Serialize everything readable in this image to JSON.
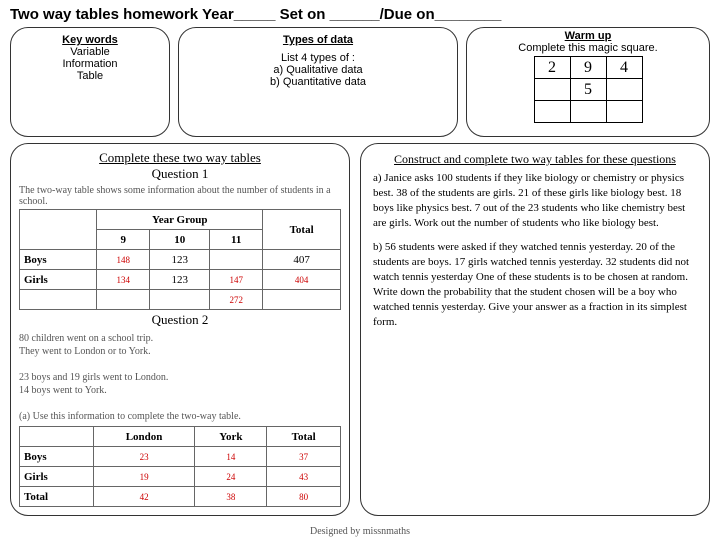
{
  "title": "Two way tables homework Year_____ Set on ______/Due on________",
  "keywords": {
    "heading": "Key words",
    "items": [
      "Variable",
      "Information",
      "Table"
    ]
  },
  "types": {
    "heading": "Types of data",
    "intro": "List 4 types of :",
    "lines": [
      "a)  Qualitative data",
      "b)  Quantitative data"
    ]
  },
  "warmup": {
    "heading": "Warm up",
    "sub": "Complete this magic  square.",
    "grid": [
      [
        "2",
        "9",
        "4"
      ],
      [
        "",
        "5",
        ""
      ],
      [
        "",
        "",
        ""
      ]
    ]
  },
  "left": {
    "head1": "Complete these two way tables",
    "q1": "Question 1",
    "t1_desc": "The two-way table shows some information about the number of students in a school.",
    "t1": {
      "cols": [
        "",
        "9",
        "10",
        "11",
        "Total"
      ],
      "rows": [
        {
          "h": "Boys",
          "c": [
            "148",
            "123",
            "",
            "407"
          ],
          "ans": [
            0
          ]
        },
        {
          "h": "Girls",
          "c": [
            "134",
            "123",
            "147",
            "404"
          ],
          "ans": [
            0,
            2,
            3
          ]
        },
        {
          "h": "",
          "c": [
            "",
            "",
            "272",
            ""
          ],
          "ans": [
            2
          ]
        }
      ],
      "yearLabel": "Year Group"
    },
    "q2": "Question 2",
    "t2_intro": "80 children went on a school trip.\nThey went to London or to York.\n\n23 boys and 19 girls went to London.\n14 boys went to York.\n\n(a)    Use this information to complete the two-way table.",
    "t2": {
      "cols": [
        "",
        "London",
        "York",
        "Total"
      ],
      "rows": [
        {
          "h": "Boys",
          "c": [
            "23",
            "14",
            "37"
          ]
        },
        {
          "h": "Girls",
          "c": [
            "19",
            "24",
            "43"
          ]
        },
        {
          "h": "Total",
          "c": [
            "42",
            "38",
            "80"
          ]
        }
      ]
    }
  },
  "right": {
    "heading": "Construct and complete two way tables for these questions",
    "a": "a) Janice asks 100 students if they like biology or chemistry or physics best. 38 of the students are girls. 21 of these girls like biology best. 18 boys like physics best. 7 out of the 23 students who like chemistry best are girls. Work out the number of students who like biology best.",
    "b": "b)   56 students were asked if they watched tennis yesterday. 20 of the students are boys. 17 girls watched tennis yesterday. 32 students did not watch tennis yesterday One of these students is to be chosen at random. Write down the probability that the student chosen will be a boy who watched tennis yesterday. Give your answer as a fraction in its simplest form."
  },
  "footer": "Designed by missnmaths"
}
